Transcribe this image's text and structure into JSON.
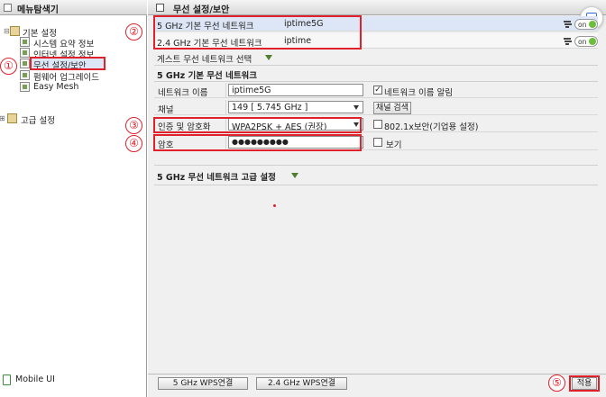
{
  "sidebar": {
    "title": "메뉴탐색기",
    "groups": [
      {
        "label": "기본 설정",
        "items": [
          "시스템 요약 정보",
          "인터넷 설정 정보",
          "무선 설정/보안",
          "펌웨어 업그레이드",
          "Easy Mesh"
        ]
      },
      {
        "label": "고급 설정"
      }
    ],
    "mobile": "Mobile UI"
  },
  "header": {
    "title": "무선 설정/보안"
  },
  "networks": [
    {
      "label": "5 GHz 기본 무선 네트워크",
      "ssid": "iptime5G",
      "toggle": "on"
    },
    {
      "label": "2.4 GHz 기본 무선 네트워크",
      "ssid": "iptime",
      "toggle": "on"
    }
  ],
  "guest_label": "게스트 무선 네트워크 선택",
  "section": {
    "title": "5 GHz 기본 무선 네트워크",
    "network_name_label": "네트워크 이름",
    "network_name_value": "iptime5G",
    "broadcast_label": "네트워크 이름 알림",
    "channel_label": "채널",
    "channel_value": "149 [ 5.745 GHz ]",
    "channel_search": "채널 검색",
    "auth_label": "인증 및 암호화",
    "auth_value": "WPA2PSK + AES (권장)",
    "enterprise_label": "802.1x보안(기업용 설정)",
    "password_label": "암호",
    "password_value": "●●●●●●●●●",
    "show_label": "보기"
  },
  "advanced_title": "5 GHz 무선 네트워크 고급 설정",
  "footer": {
    "wps5": "5 GHz WPS연결",
    "wps24": "2.4 GHz WPS연결",
    "apply": "적용"
  },
  "markers": [
    "①",
    "②",
    "③",
    "④",
    "⑤"
  ],
  "colors": {
    "highlight": "#e0202a",
    "selected_row": "#dde6f6",
    "toggle_on": "#6bbf3c"
  }
}
